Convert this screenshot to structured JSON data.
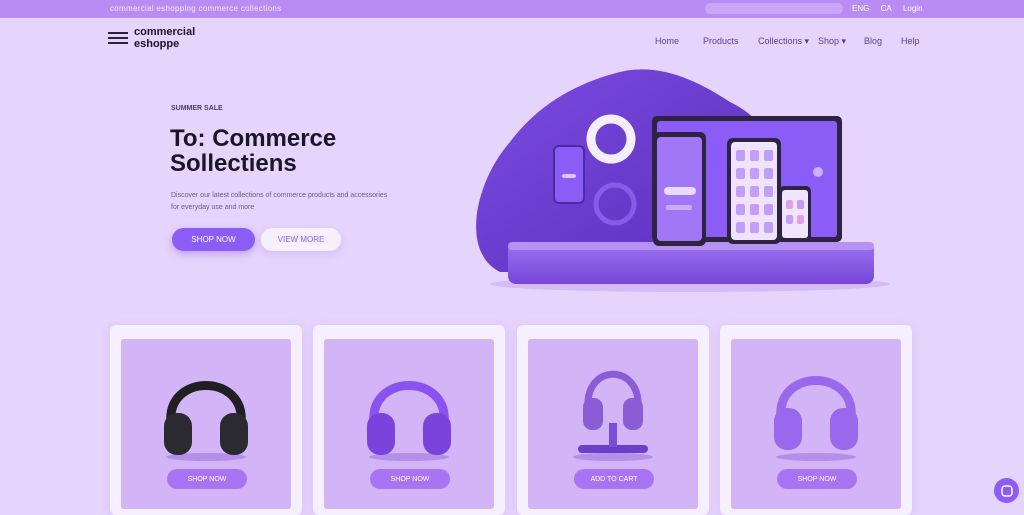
{
  "topbar": {
    "promo": "commercial eshopping commerce collections",
    "links": [
      "ENG",
      "CA",
      "Login"
    ]
  },
  "header": {
    "logo_line1": "commercial",
    "logo_line2": "eshoppe",
    "nav": [
      "Home",
      "Products",
      "Collections ▾",
      "Shop ▾",
      "Blog",
      "Help"
    ]
  },
  "hero": {
    "eyebrow": "SUMMER SALE",
    "title": "To: Commerce Sollectiens",
    "description": "Discover our latest collections of commerce products and accessories for everyday use and more",
    "primary_button": "SHOP NOW",
    "secondary_button": "VIEW MORE"
  },
  "products": [
    {
      "button": "SHOP NOW",
      "color": "#1f1f24"
    },
    {
      "button": "SHOP NOW",
      "color": "#8a52ee"
    },
    {
      "button": "ADD TO CART",
      "color": "#8a5cd6"
    },
    {
      "button": "SHOP NOW",
      "color": "#9a68ec"
    }
  ],
  "colors": {
    "accent": "#8b5cf6",
    "background": "#e5d4fb",
    "topbar": "#b88cf3"
  }
}
